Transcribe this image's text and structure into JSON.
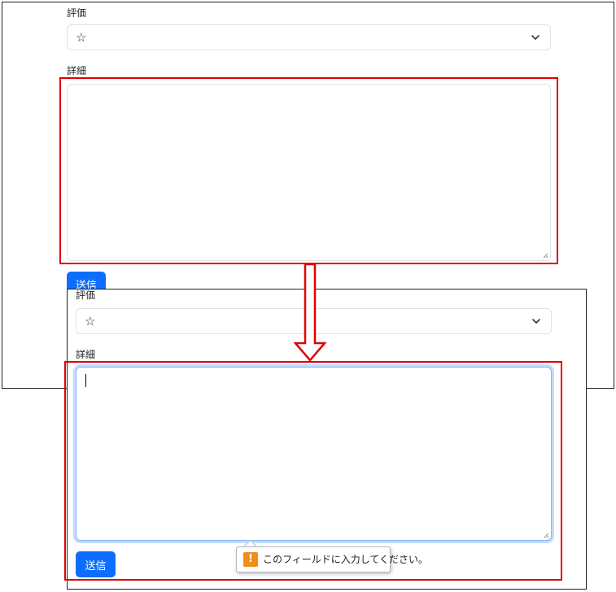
{
  "before": {
    "rating_label": "評価",
    "rating_value": "☆",
    "details_label": "詳細",
    "details_value": "",
    "submit_label": "送信"
  },
  "after": {
    "rating_label": "評価",
    "rating_value": "☆",
    "details_label": "詳細",
    "details_value": "",
    "submit_label": "送信"
  },
  "validation_tooltip": {
    "icon_glyph": "!",
    "message": "このフィールドに入力してください。"
  },
  "colors": {
    "primary_button": "#0d6efd",
    "highlight_box": "#e00000",
    "focus_border": "#86b7fe",
    "warning_icon": "#f28c18"
  },
  "icons": {
    "select_chevron": "chevron-down-icon",
    "warning": "warning-icon",
    "transition_arrow": "arrow-down-icon"
  }
}
